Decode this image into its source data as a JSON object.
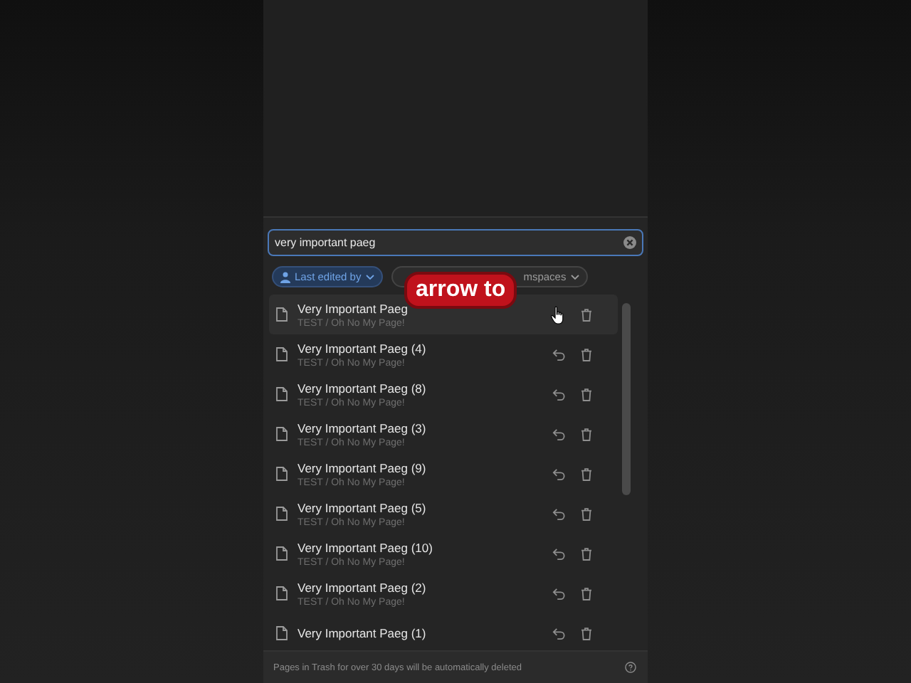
{
  "search": {
    "value": "very important paeg"
  },
  "filters": [
    {
      "label": "Last edited by",
      "kind": "person",
      "active": true
    },
    {
      "label": "mspaces",
      "kind": "workspace",
      "active": false
    }
  ],
  "caption": "arrow to",
  "rows": [
    {
      "name": "Very Important Paeg",
      "path": "TEST / Oh No My Page!",
      "hovered": true
    },
    {
      "name": "Very Important Paeg (4)",
      "path": "TEST / Oh No My Page!",
      "hovered": false
    },
    {
      "name": "Very Important Paeg (8)",
      "path": "TEST / Oh No My Page!",
      "hovered": false
    },
    {
      "name": "Very Important Paeg (3)",
      "path": "TEST / Oh No My Page!",
      "hovered": false
    },
    {
      "name": "Very Important Paeg (9)",
      "path": "TEST / Oh No My Page!",
      "hovered": false
    },
    {
      "name": "Very Important Paeg (5)",
      "path": "TEST / Oh No My Page!",
      "hovered": false
    },
    {
      "name": "Very Important Paeg (10)",
      "path": "TEST / Oh No My Page!",
      "hovered": false
    },
    {
      "name": "Very Important Paeg (2)",
      "path": "TEST / Oh No My Page!",
      "hovered": false
    },
    {
      "name": "Very Important Paeg (1)",
      "hovered": false
    }
  ],
  "footer": "Pages in Trash for over 30 days will be automatically deleted"
}
